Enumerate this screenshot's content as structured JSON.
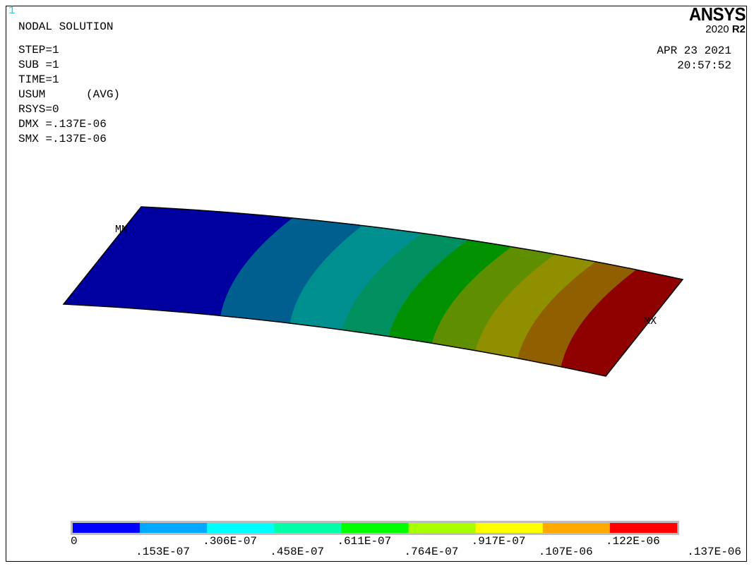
{
  "window_number": "1",
  "title": "NODAL SOLUTION",
  "info": {
    "step": "STEP=1",
    "sub": "SUB =1",
    "time": "TIME=1",
    "usum": "USUM      (AVG)",
    "rsys": "RSYS=0",
    "dmx": "DMX =.137E-06",
    "smx": "SMX =.137E-06"
  },
  "date": "APR 23 2021",
  "time": "20:57:52",
  "logo": {
    "brand": "ANSYS",
    "year": "2020",
    "release": "R2"
  },
  "markers": {
    "min": "MN",
    "max": "MX"
  },
  "contour_colors": [
    "#0000a0",
    "#005f8e",
    "#008f8f",
    "#008f5f",
    "#009000",
    "#5f8f00",
    "#8f8f00",
    "#8f5f00",
    "#8f0000"
  ],
  "legend": {
    "colors": [
      "#0000ff",
      "#00a8ff",
      "#00ffff",
      "#00ffa8",
      "#00ff00",
      "#a8ff00",
      "#ffff00",
      "#ffa800",
      "#ff0000"
    ],
    "ticks": [
      "0",
      ".153E-07",
      ".306E-07",
      ".458E-07",
      ".611E-07",
      ".764E-07",
      ".917E-07",
      ".107E-06",
      ".122E-06",
      ".137E-06"
    ]
  }
}
